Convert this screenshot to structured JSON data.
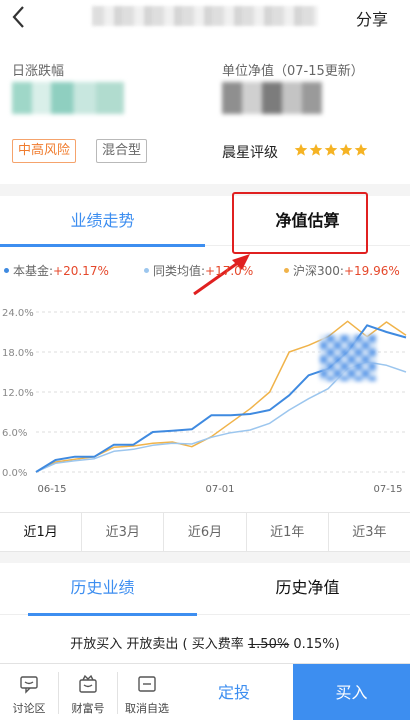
{
  "header": {
    "share_label": "分享"
  },
  "info": {
    "day_change_label": "日涨跌幅",
    "nav_label": "单位净值（07-15更新）",
    "risk_tag": "中高风险",
    "type_tag": "混合型",
    "rating_label": "晨星评级",
    "rating_stars": 5
  },
  "tabs": {
    "performance": "业绩走势",
    "nav_estimate": "净值估算"
  },
  "legend": {
    "fund_name": "本基金:",
    "fund_value": "+20.17%",
    "peer_name": "同类均值:",
    "peer_value": "+17.0%",
    "csi_name": "沪深300:",
    "csi_value": "+19.96%"
  },
  "colors": {
    "accent": "#3d8ef0",
    "fund": "#3f8ae0",
    "peer": "#9cc6ee",
    "csi": "#f0b34a",
    "red": "#e02020"
  },
  "chart_data": {
    "type": "line",
    "y_ticks": [
      "24.0%",
      "18.0%",
      "12.0%",
      "6.0%",
      "0.0%"
    ],
    "x_ticks": [
      "06-15",
      "07-01",
      "07-15"
    ],
    "ylim": [
      0,
      24
    ],
    "series": [
      {
        "name": "本基金",
        "values": [
          0,
          1.8,
          2.3,
          2.3,
          4.1,
          4.1,
          6.0,
          6.2,
          6.4,
          8.5,
          8.5,
          8.7,
          9.3,
          11.5,
          14.5,
          15.5,
          18.0,
          22.0,
          21.0,
          20.17
        ]
      },
      {
        "name": "同类均值",
        "values": [
          0,
          1.3,
          1.7,
          2.0,
          3.1,
          3.4,
          4.0,
          4.3,
          4.2,
          5.2,
          5.9,
          6.3,
          7.3,
          9.3,
          11.0,
          12.5,
          15.5,
          16.5,
          16.0,
          15.0
        ]
      },
      {
        "name": "沪深300",
        "values": [
          0,
          1.5,
          1.9,
          2.3,
          3.7,
          3.9,
          4.3,
          4.5,
          3.8,
          5.3,
          7.4,
          9.5,
          12.0,
          18.0,
          19.0,
          20.3,
          22.6,
          20.3,
          22.5,
          20.5
        ]
      }
    ]
  },
  "periods": [
    "近1月",
    "近3月",
    "近6月",
    "近1年",
    "近3年"
  ],
  "tabs2": {
    "history_perf": "历史业绩",
    "history_nav": "历史净值"
  },
  "trade": {
    "open_buy": "开放买入",
    "open_sell": "开放卖出",
    "rate_prefix": "( 买入费率",
    "rate_orig": "1.50%",
    "rate_now": "0.15%",
    "rate_suffix": ")"
  },
  "bottom": {
    "discuss": "讨论区",
    "wealth": "财富号",
    "unfav": "取消自选",
    "dingtou": "定投",
    "buy": "买入"
  }
}
